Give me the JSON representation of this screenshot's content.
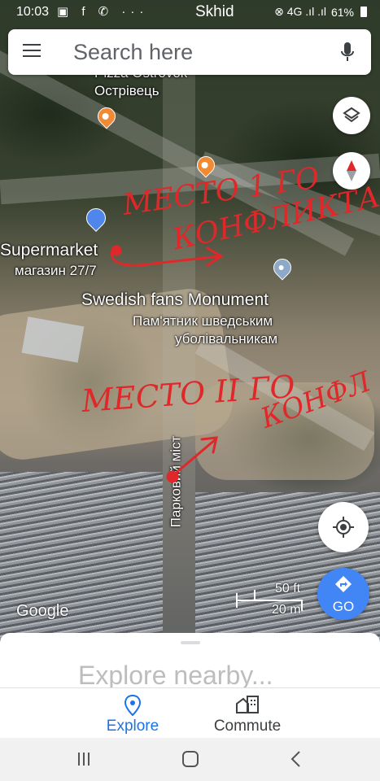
{
  "status_bar": {
    "time": "10:03",
    "app_icons": "▣ f ✆ ···",
    "location": "Skhid",
    "indicators": "⊗ 4G .ıl .ıl",
    "battery": "61%"
  },
  "search": {
    "placeholder": "Search here"
  },
  "map": {
    "labels": {
      "pizza_name": "Pizza Ostrovok",
      "pizza_local": "Острівець",
      "supermarket_name": "Supermarket",
      "supermarket_local": "магазин 27/7",
      "monument_name": "Swedish fans Monument",
      "monument_local_line1": "Пам'ятник шведським",
      "monument_local_line2": "уболівальникам",
      "bridge": "Парковий міст"
    },
    "annotations": {
      "first_line1": "МЕСТО 1 ГО",
      "first_line2": "КОНФЛИКТА",
      "second_line1": "МЕСТО II ГО",
      "second_line2": "КОНФЛ"
    },
    "attribution": "Google",
    "scale": {
      "feet": "50 ft",
      "meters": "20 m"
    },
    "accent_color": "#4285f4",
    "annotation_color": "#e0282a"
  },
  "controls": {
    "layers": "layers-icon",
    "compass": "compass-icon",
    "my_location": "my-location-icon",
    "go_label": "GO"
  },
  "sheet": {
    "explore_nearby": "Explore nearby..."
  },
  "tabs": [
    {
      "label": "Explore",
      "icon": "place-icon",
      "active": true
    },
    {
      "label": "Commute",
      "icon": "commute-icon",
      "active": false
    }
  ],
  "system_nav": [
    "recents-icon",
    "home-icon",
    "back-icon"
  ]
}
